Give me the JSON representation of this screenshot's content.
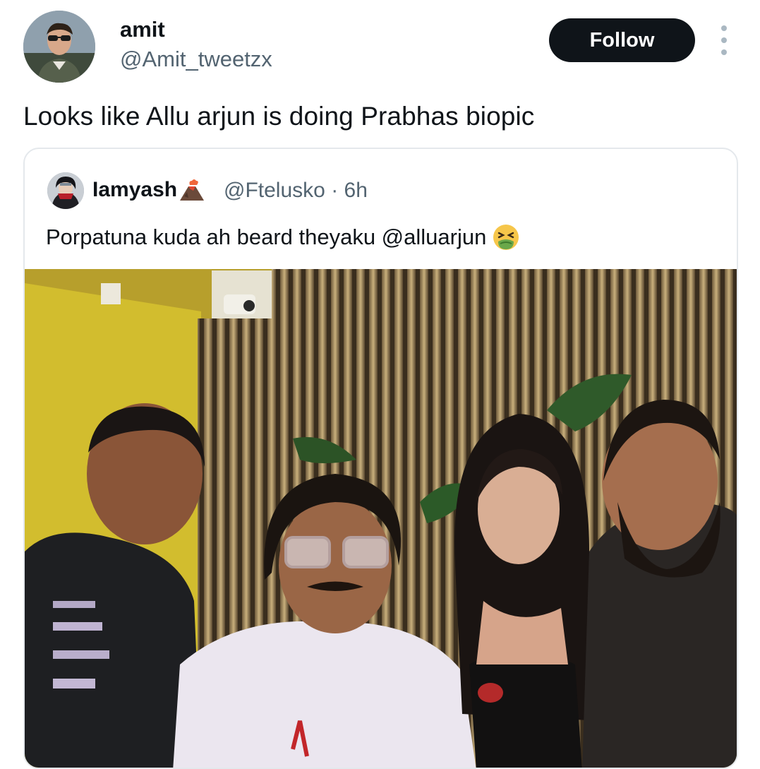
{
  "tweet": {
    "display_name": "amit",
    "handle": "@Amit_tweetzx",
    "follow_label": "Follow",
    "text": "Looks like Allu arjun is doing Prabhas biopic"
  },
  "quoted": {
    "display_name": "Iamyash",
    "name_emoji": "volcano-icon",
    "handle": "@Ftelusko",
    "separator": "·",
    "time": "6h",
    "text": "Porpatuna kuda ah beard theyaku @alluarjun",
    "text_emoji": "nauseated-face-icon"
  },
  "colors": {
    "primary_text": "#0f1419",
    "secondary_text": "#536471",
    "follow_bg": "#0f1419",
    "card_border": "#e4e8ec"
  }
}
